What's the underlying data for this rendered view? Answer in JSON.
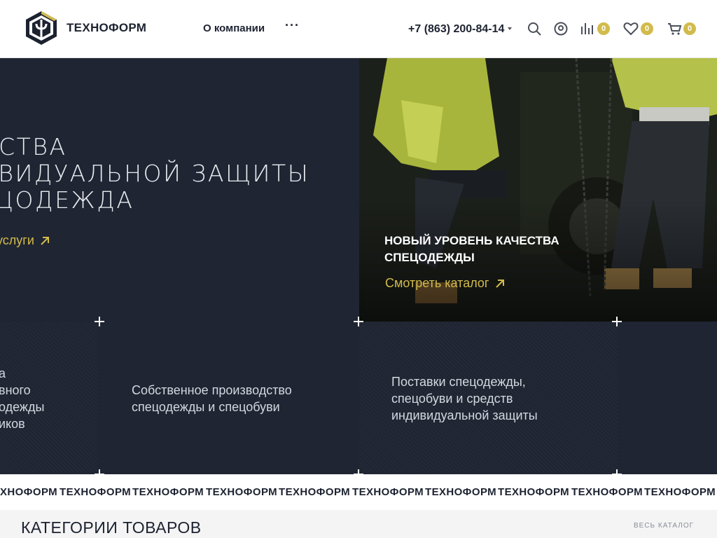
{
  "header": {
    "logo_text": "ТЕХНОФОРМ",
    "nav_about": "О компании",
    "nav_more": "···",
    "phone": "+7 (863) 200-84-14",
    "compare_count": "0",
    "favorites_count": "0",
    "cart_count": "0",
    "icons": [
      "search-icon",
      "user-icon",
      "compare-icon",
      "heart-icon",
      "cart-icon",
      "chevron-down-icon"
    ]
  },
  "hero": {
    "title_lines": [
      "ДСТВА",
      "ИВИДУАЛЬНОЙ ЗАЩИТЫ",
      "ЕЦОДЕЖДА"
    ],
    "services_link": "услуги",
    "promo_title_line1": "НОВЫЙ УРОВЕНЬ КАЧЕСТВА",
    "promo_title_line2": "СПЕЦОДЕЖДЫ",
    "promo_link": "Смотреть каталог",
    "feature_left_lines": [
      "а",
      "вного",
      "одежды",
      "иков"
    ],
    "feature_middle_lines": [
      "Собственное производство",
      "спецодежды и спецобуви"
    ],
    "feature_right_lines": [
      "Поставки спецодежды,",
      "спецобуви и средств",
      "индивидуальной защиты"
    ]
  },
  "marquee": {
    "items": [
      "ТЕХНОФОРМ",
      "ТЕХНОФОРМ",
      "ТЕХНОФОРМ",
      "ТЕХНОФОРМ",
      "ТЕХНОФОРМ",
      "ТЕХНОФОРМ",
      "ТЕХНОФОРМ",
      "ТЕХНОФОРМ",
      "ТЕХНОФОРМ",
      "ТЕХНОФОРМ"
    ]
  },
  "categories": {
    "title": "КАТЕГОРИИ ТОВАРОВ",
    "all_link": "ВЕСЬ КАТАЛОГ"
  },
  "colors": {
    "accent": "#d2bb4b",
    "dark": "#1f2532",
    "text": "#1c2230"
  }
}
